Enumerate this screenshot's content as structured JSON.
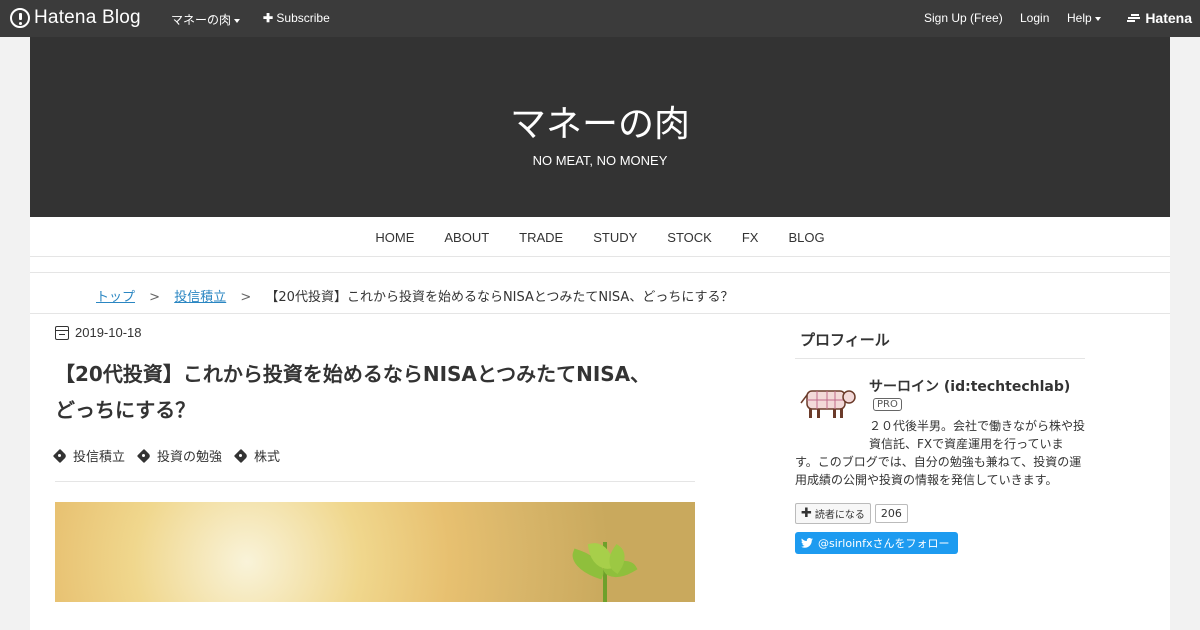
{
  "topbar": {
    "logo_text": "Hatena Blog",
    "blog_menu": "マネーの肉",
    "subscribe": "Subscribe",
    "signup": "Sign Up (Free)",
    "login": "Login",
    "help": "Help",
    "hatena": "Hatena"
  },
  "header": {
    "title": "マネーの肉",
    "description": "NO MEAT, NO MONEY"
  },
  "nav": {
    "items": [
      "HOME",
      "ABOUT",
      "TRADE",
      "STUDY",
      "STOCK",
      "FX",
      "BLOG"
    ]
  },
  "breadcrumb": {
    "top": "トップ",
    "category": "投信積立",
    "sep": ">",
    "current": "【20代投資】これから投資を始めるならNISAとつみたてNISA、どっちにする？"
  },
  "entry": {
    "date": "2019-10-18",
    "title_line1": "【20代投資】これから投資を始めるならNISAとつみたてNISA、",
    "title_line2": "どっちにする？",
    "tags": [
      "投信積立",
      "投資の勉強",
      "株式"
    ]
  },
  "sidebar": {
    "profile_heading": "プロフィール",
    "name": "サーロイン (id:techtechlab)",
    "badge": "PRO",
    "desc_line1": "２０代後半男。会社で働きながら株や投",
    "desc_line2": "資信託、FXで資産運用を行っていま",
    "desc_rest": "す。このブログでは、自分の勉強も兼ねて、投資の運用成績の公開や投資の情報を発信していきます。",
    "reader_button": "読者になる",
    "reader_count": "206",
    "twitter_button": "@sirloinfxさんをフォロー"
  },
  "colors": {
    "topbar_bg": "#3b3b3b",
    "header_bg": "#333333",
    "link": "#2a86c2",
    "twitter": "#1d9bf0"
  }
}
